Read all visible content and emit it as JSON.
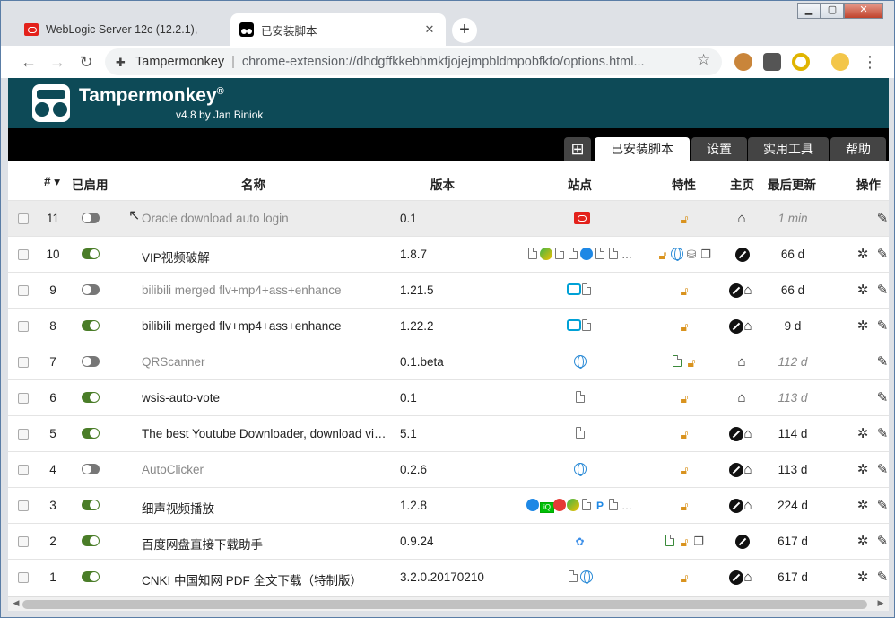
{
  "browser": {
    "tabs": [
      {
        "title": "WebLogic Server 12c (12.2.1),",
        "icon": "oracle-icon"
      },
      {
        "title": "已安装脚本",
        "icon": "tampermonkey-icon"
      }
    ],
    "newtab_label": "+",
    "omnibox": {
      "ext_name": "Tampermonkey",
      "url": "chrome-extension://dhdgffkkebhmkfjojejmpbldmpobfkfo/options.html..."
    }
  },
  "tm": {
    "title": "Tampermonkey",
    "registered": "®",
    "subtitle": "v4.8 by Jan Biniok",
    "tabs": {
      "add": "⊞",
      "installed": "已安装脚本",
      "settings": "设置",
      "tools": "实用工具",
      "help": "帮助"
    }
  },
  "table": {
    "headers": {
      "num": "# ▾",
      "enabled": "已启用",
      "name": "名称",
      "version": "版本",
      "sites": "站点",
      "features": "特性",
      "homepage": "主页",
      "updated": "最后更新",
      "actions": "操作"
    },
    "rows": [
      {
        "num": "11",
        "enabled": false,
        "name": "Oracle download auto login",
        "version": "0.1",
        "updated": "1 min",
        "italic": true,
        "sites": [
          "oracle"
        ],
        "features": [
          "lock"
        ],
        "home": [
          "house"
        ],
        "actions": [
          "edit"
        ],
        "highlight": true
      },
      {
        "num": "10",
        "enabled": true,
        "name": "VIP视频破解",
        "version": "1.8.7",
        "updated": "66 d",
        "italic": false,
        "sites": [
          "page",
          "play-green",
          "page",
          "page",
          "play-blue",
          "page",
          "page",
          "more"
        ],
        "features": [
          "lock",
          "globe",
          "db",
          "window"
        ],
        "home": [
          "ball"
        ],
        "actions": [
          "bug",
          "edit"
        ],
        "highlight": false
      },
      {
        "num": "9",
        "enabled": false,
        "name": "bilibili merged flv+mp4+ass+enhance",
        "version": "1.21.5",
        "updated": "66 d",
        "italic": false,
        "sites": [
          "tv",
          "page"
        ],
        "features": [
          "lock"
        ],
        "home": [
          "ball",
          "house"
        ],
        "actions": [
          "bug",
          "edit"
        ],
        "highlight": false
      },
      {
        "num": "8",
        "enabled": true,
        "name": "bilibili merged flv+mp4+ass+enhance",
        "version": "1.22.2",
        "updated": "9 d",
        "italic": false,
        "sites": [
          "tv",
          "page"
        ],
        "features": [
          "lock"
        ],
        "home": [
          "ball",
          "house"
        ],
        "actions": [
          "bug",
          "edit"
        ],
        "highlight": false
      },
      {
        "num": "7",
        "enabled": false,
        "name": "QRScanner",
        "version": "0.1.beta",
        "updated": "112 d",
        "italic": true,
        "sites": [
          "globe"
        ],
        "features": [
          "code",
          "lock"
        ],
        "home": [
          "house"
        ],
        "actions": [
          "edit"
        ],
        "highlight": false
      },
      {
        "num": "6",
        "enabled": true,
        "name": "wsis-auto-vote",
        "version": "0.1",
        "updated": "113 d",
        "italic": true,
        "sites": [
          "page"
        ],
        "features": [
          "lock"
        ],
        "home": [
          "house"
        ],
        "actions": [
          "edit"
        ],
        "highlight": false
      },
      {
        "num": "5",
        "enabled": true,
        "name": "The best Youtube Downloader, download video from ...",
        "version": "5.1",
        "updated": "114 d",
        "italic": false,
        "sites": [
          "page"
        ],
        "features": [
          "lock"
        ],
        "home": [
          "ball",
          "house"
        ],
        "actions": [
          "bug",
          "edit"
        ],
        "highlight": false
      },
      {
        "num": "4",
        "enabled": false,
        "name": "AutoClicker",
        "version": "0.2.6",
        "updated": "113 d",
        "italic": false,
        "sites": [
          "globe"
        ],
        "features": [
          "lock"
        ],
        "home": [
          "ball",
          "house"
        ],
        "actions": [
          "bug",
          "edit"
        ],
        "highlight": false
      },
      {
        "num": "3",
        "enabled": true,
        "name": "细声视频播放",
        "version": "1.2.8",
        "updated": "224 d",
        "italic": false,
        "sites": [
          "play-blue",
          "iqiyi",
          "play-red",
          "play-green",
          "page",
          "pp",
          "page",
          "more"
        ],
        "features": [
          "lock"
        ],
        "home": [
          "ball",
          "house"
        ],
        "actions": [
          "bug",
          "edit"
        ],
        "highlight": false
      },
      {
        "num": "2",
        "enabled": true,
        "name": "百度网盘直接下载助手",
        "version": "0.9.24",
        "updated": "617 d",
        "italic": false,
        "sites": [
          "baidu"
        ],
        "features": [
          "code",
          "lock",
          "window"
        ],
        "home": [
          "ball"
        ],
        "actions": [
          "bug",
          "edit"
        ],
        "highlight": false
      },
      {
        "num": "1",
        "enabled": true,
        "name": "CNKI 中国知网 PDF 全文下载（特制版）",
        "version": "3.2.0.20170210",
        "updated": "617 d",
        "italic": false,
        "sites": [
          "page",
          "globe"
        ],
        "features": [
          "lock"
        ],
        "home": [
          "ball",
          "house"
        ],
        "actions": [
          "bug",
          "edit"
        ],
        "highlight": false
      }
    ]
  },
  "colors": {
    "header_bg": "#0d4a57",
    "toggle_on": "#4a7d28",
    "lock": "#d9931e"
  }
}
